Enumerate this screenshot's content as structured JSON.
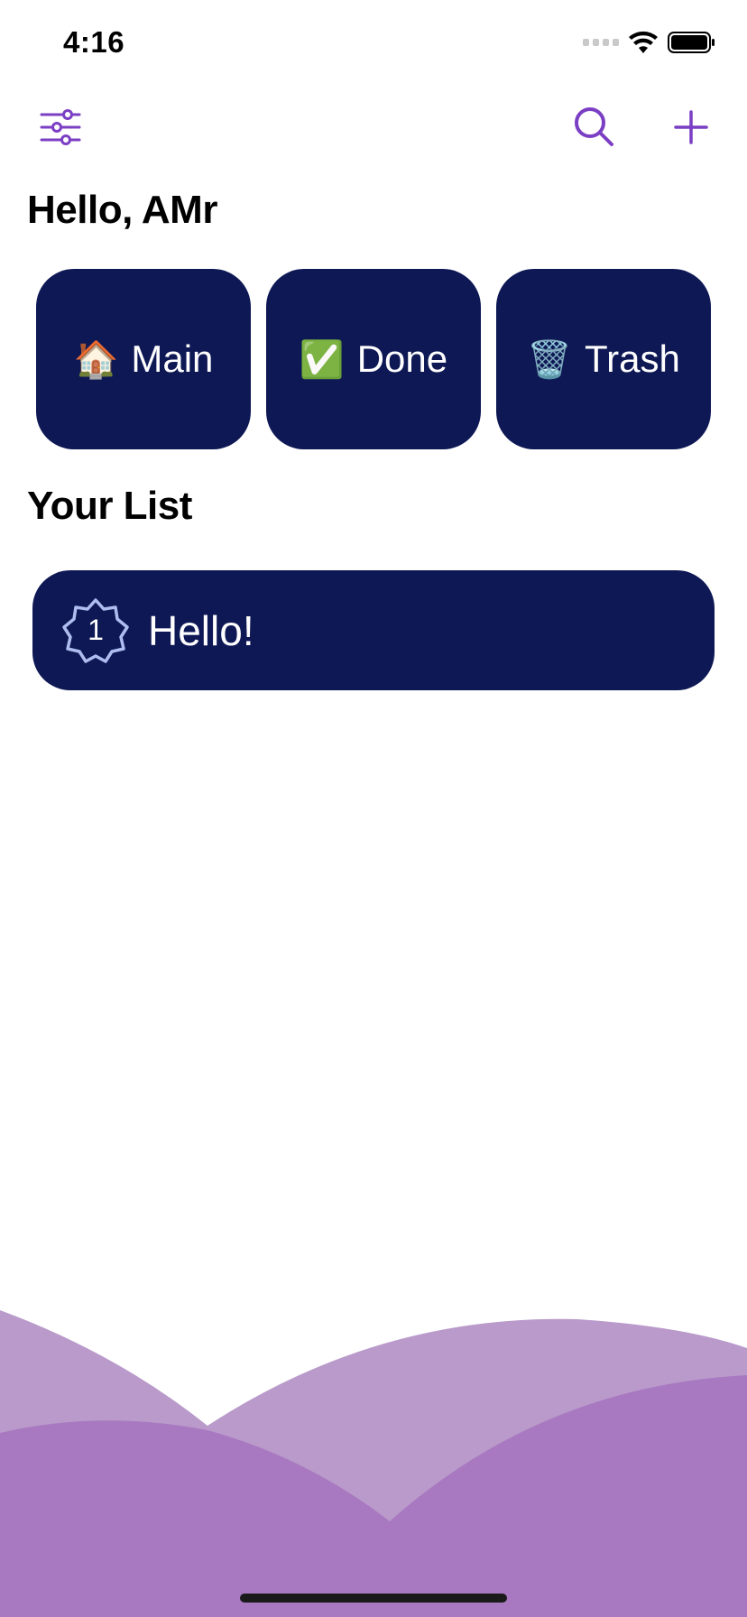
{
  "status_bar": {
    "time": "4:16",
    "signal_icon": "cellular-signal-icon",
    "wifi_icon": "wifi-icon",
    "battery_icon": "battery-icon"
  },
  "toolbar": {
    "filter_icon": "sliders-icon",
    "search_icon": "search-icon",
    "add_icon": "plus-icon",
    "accent_color": "#7b3fc4"
  },
  "greeting": "Hello, AMr",
  "categories": [
    {
      "emoji": "🏠",
      "label": "Main"
    },
    {
      "emoji": "✅",
      "label": "Done"
    },
    {
      "emoji": "🗑️",
      "label": "Trash"
    }
  ],
  "list_section": {
    "title": "Your List",
    "items": [
      {
        "badge_number": "1",
        "label": "Hello!"
      }
    ]
  },
  "colors": {
    "card_background": "#0e1855",
    "badge_outline": "#aebdf0",
    "wave_light": "#b99aca",
    "wave_dark": "#a879c0"
  }
}
